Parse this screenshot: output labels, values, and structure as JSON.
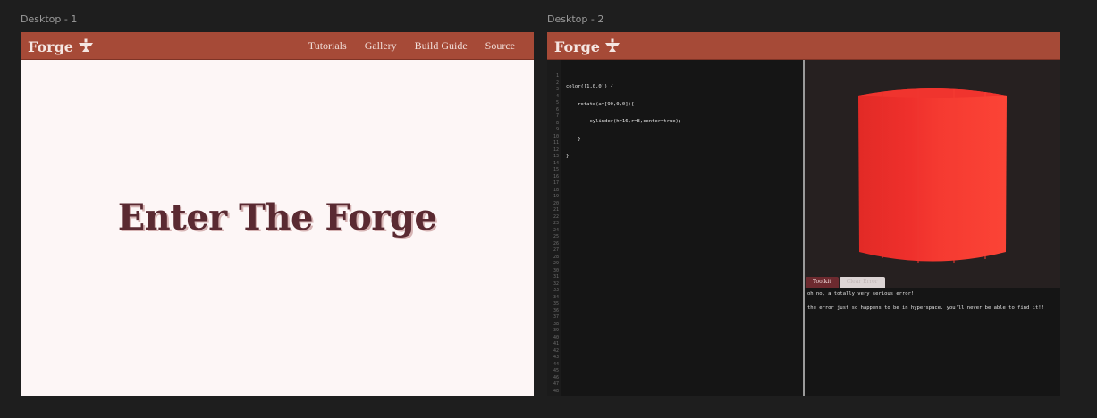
{
  "frames": {
    "desktop1_label": "Desktop - 1",
    "desktop2_label": "Desktop - 2"
  },
  "nav": {
    "logo": "Forge",
    "links": [
      "Tutorials",
      "Gallery",
      "Build Guide",
      "Source"
    ]
  },
  "hero": {
    "title": "Enter The Forge"
  },
  "editor": {
    "code": [
      "color([1,0,0]) {",
      "    rotate(a=[90,0,0]){",
      "        cylinder(h=16,r=8,center=true);",
      "    }",
      "}"
    ],
    "line_count": 48
  },
  "viewer": {
    "object": "cylinder",
    "color": "#f43a32"
  },
  "tabs": {
    "active": "Toolkit",
    "inactive": "Clear Error"
  },
  "console": {
    "lines": [
      "oh no, a totally very serious error!",
      "",
      "the error just so happens to be in hyperspace. you'll never be able to find it!!"
    ]
  },
  "colors": {
    "brand": "#a64a37",
    "hero_text": "#5a2a32",
    "page_bg": "#fdf6f6"
  }
}
